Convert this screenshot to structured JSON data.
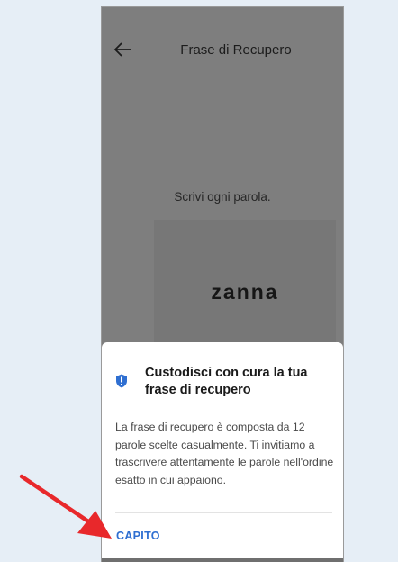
{
  "header": {
    "title": "Frase di Recupero"
  },
  "main": {
    "instruction": "Scrivi ogni parola.",
    "word": "zanna"
  },
  "sheet": {
    "title": "Custodisci con cura la tua frase di recupero",
    "body": "La frase di recupero è composta da 12 parole scelte casualmente. Ti invitiamo a trascrivere attentamente le parole nell'ordine esatto in cui appaiono.",
    "button_label": "CAPITO"
  },
  "icons": {
    "back": "arrow-left-icon",
    "info": "info-shield-icon",
    "annotation": "red-pointer-arrow"
  },
  "colors": {
    "page_background": "#e6eef6",
    "dim_overlay": "#7e7e7e",
    "accent": "#2f6fd1",
    "annotation_red": "#e8282b"
  }
}
